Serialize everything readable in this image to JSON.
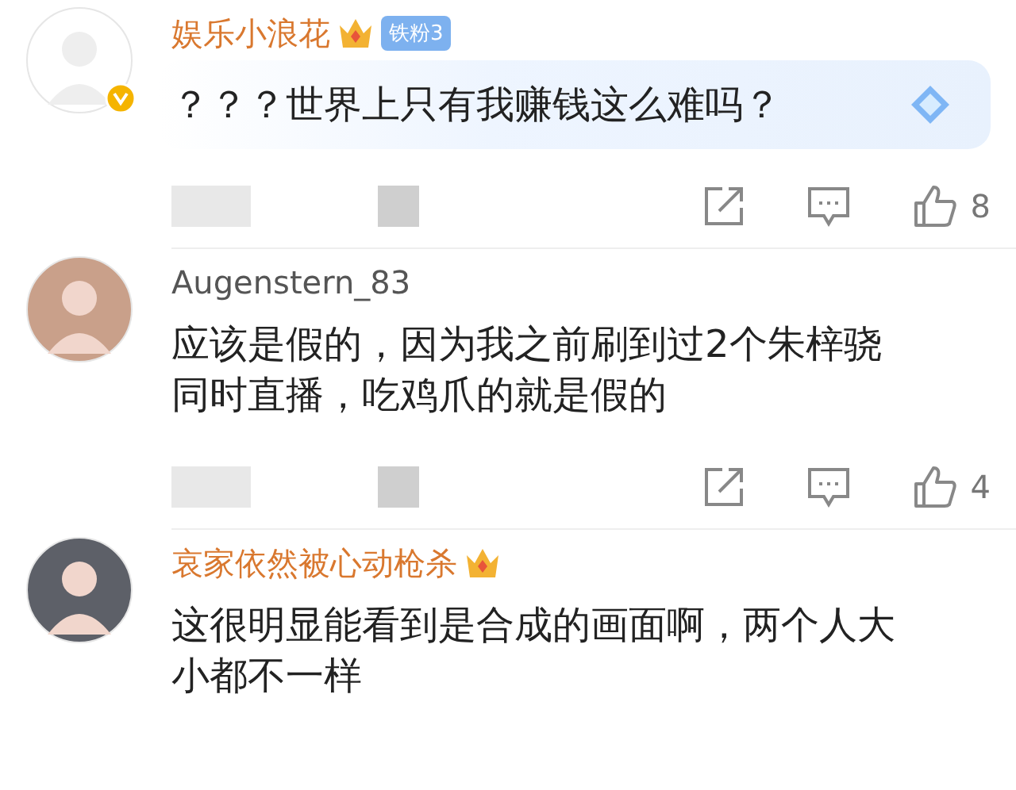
{
  "comments": [
    {
      "username": "娱乐小浪花",
      "vip": true,
      "verified": true,
      "crown": true,
      "fan_badge": "铁粉3",
      "text": "？？？世界上只有我赚钱这么难吗？",
      "highlighted": true,
      "likes": "8"
    },
    {
      "username": "Augenstern_83",
      "vip": false,
      "verified": false,
      "crown": false,
      "text": "应该是假的，因为我之前刷到过2个朱梓骁同时直播，吃鸡爪的就是假的",
      "highlighted": false,
      "likes": "4"
    },
    {
      "username": "哀家依然被心动枪杀",
      "vip": true,
      "verified": false,
      "crown": true,
      "text": "这很明显能看到是合成的画面啊，两个人大小都不一样",
      "highlighted": false
    }
  ]
}
